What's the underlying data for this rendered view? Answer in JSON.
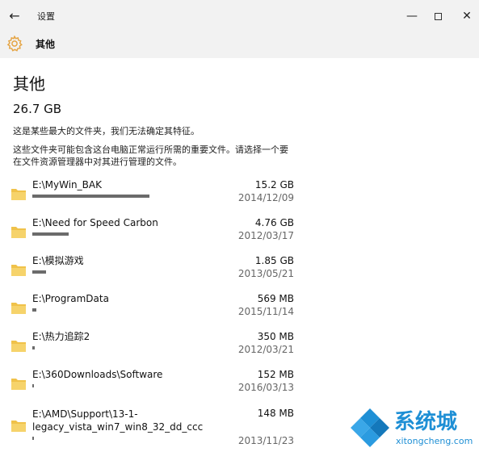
{
  "window": {
    "title": "设置",
    "back_glyph": "←",
    "min_glyph": "—",
    "close_glyph": "✕"
  },
  "header": {
    "title": "其他",
    "icon": "gear-icon",
    "accent": "#e5a443"
  },
  "main": {
    "title": "其他",
    "total_size": "26.7 GB",
    "desc1": "这是某些最大的文件夹，我们无法确定其特征。",
    "desc2": "这些文件夹可能包含这台电脑正常运行所需的重要文件。请选择一个要在文件资源管理器中对其进行管理的文件。"
  },
  "folders": [
    {
      "path": "E:\\MyWin_BAK",
      "size": "15.2 GB",
      "date": "2014/12/09",
      "usage_fraction": 1.0
    },
    {
      "path": "E:\\Need for Speed Carbon",
      "size": "4.76 GB",
      "date": "2012/03/17",
      "usage_fraction": 0.31
    },
    {
      "path": "E:\\模拟游戏",
      "size": "1.85 GB",
      "date": "2013/05/21",
      "usage_fraction": 0.12
    },
    {
      "path": "E:\\ProgramData",
      "size": "569 MB",
      "date": "2015/11/14",
      "usage_fraction": 0.037
    },
    {
      "path": "E:\\热力追踪2",
      "size": "350 MB",
      "date": "2012/03/21",
      "usage_fraction": 0.023
    },
    {
      "path": "E:\\360Downloads\\Software",
      "size": "152 MB",
      "date": "2016/03/13",
      "usage_fraction": 0.01
    },
    {
      "path": "E:\\AMD\\Support\\13-1-legacy_vista_win7_win8_32_dd_ccc",
      "size": "148 MB",
      "date": "2013/11/23",
      "usage_fraction": 0.01
    }
  ],
  "colors": {
    "folder": "#f0c24a",
    "bar": "#6b6b6b",
    "watermark": "#1e8fd5"
  },
  "watermark": {
    "brand": "系统城",
    "url": "xitongcheng.com"
  }
}
